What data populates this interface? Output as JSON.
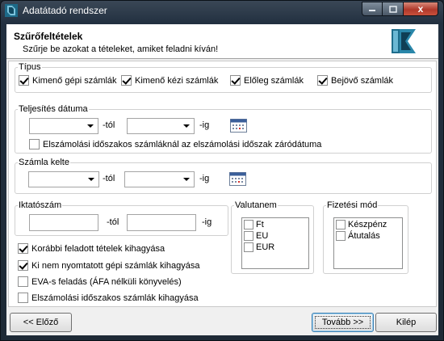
{
  "window": {
    "title": "Adatátadó rendszer",
    "minimize_icon": "minimize-icon",
    "maximize_icon": "maximize-icon",
    "close_icon": "close-icon",
    "close_glyph": "x"
  },
  "header": {
    "title": "Szűrőfeltételek",
    "subtitle": "Szűrje be azokat a tételeket, amiket feladni kíván!",
    "logo_icon": "app-logo-icon"
  },
  "tipus": {
    "label": "Típus",
    "options": [
      {
        "label": "Kimenő gépi számlák",
        "checked": true
      },
      {
        "label": "Kimenő kézi számlák",
        "checked": true
      },
      {
        "label": "Előleg számlák",
        "checked": true
      },
      {
        "label": "Bejövő számlák",
        "checked": true
      }
    ]
  },
  "teljesites": {
    "label": "Teljesítés dátuma",
    "from_value": "",
    "from_suffix": "-tól",
    "to_value": "",
    "to_suffix": "-ig",
    "calendar_icon": "calendar-icon",
    "closing_date_option": {
      "label": "Elszámolási időszakos számláknál az elszámolási időszak záródátuma",
      "checked": false
    }
  },
  "szamla_kelte": {
    "label": "Számla kelte",
    "from_value": "",
    "from_suffix": "-tól",
    "to_value": "",
    "to_suffix": "-ig",
    "calendar_icon": "calendar-icon"
  },
  "iktatoszam": {
    "label": "Iktatószám",
    "from_value": "",
    "from_suffix": "-tól",
    "to_value": "",
    "to_suffix": "-ig"
  },
  "valutanem": {
    "label": "Valutanem",
    "items": [
      {
        "label": "Ft",
        "checked": false
      },
      {
        "label": "EU",
        "checked": false
      },
      {
        "label": "EUR",
        "checked": false
      }
    ]
  },
  "fizetesi_mod": {
    "label": "Fizetési mód",
    "items": [
      {
        "label": "Készpénz",
        "checked": false
      },
      {
        "label": "Átutalás",
        "checked": false
      }
    ]
  },
  "options": [
    {
      "label": "Korábbi feladott tételek kihagyása",
      "checked": true
    },
    {
      "label": "Ki nem nyomtatott gépi számlák kihagyása",
      "checked": true
    },
    {
      "label": "EVA-s feladás (ÁFA nélküli könyvelés)",
      "checked": false
    },
    {
      "label": "Elszámolási időszakos számlák kihagyása",
      "checked": false
    }
  ],
  "footer": {
    "prev_label": "<< Előző",
    "next_label": "Tovább >>",
    "exit_label": "Kilép"
  },
  "colors": {
    "title_bar": "#223040",
    "logo": "#1f6f8c",
    "close_button": "#c8503c"
  }
}
